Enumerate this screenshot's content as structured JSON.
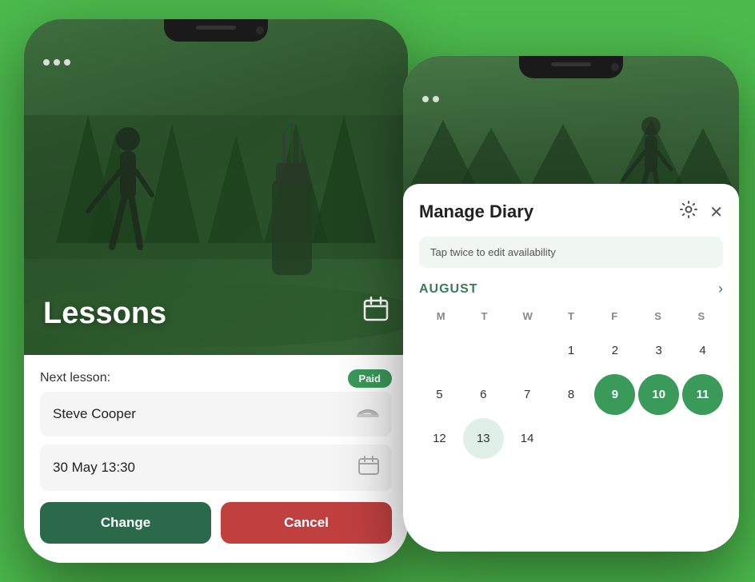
{
  "background_color": "#4cba4c",
  "phone_lessons": {
    "hero": {
      "dots_count": 3,
      "title": "Lessons",
      "calendar_icon": "📅"
    },
    "card": {
      "next_lesson_label": "Next lesson:",
      "paid_badge": "Paid",
      "student_name": "Steve Cooper",
      "student_icon": "🧢",
      "date_time": "30 May  13:30",
      "date_icon": "📅",
      "btn_change": "Change",
      "btn_cancel": "Cancel"
    }
  },
  "phone_diary": {
    "dots_count": 2,
    "modal": {
      "title": "Manage Diary",
      "settings_icon": "⚙",
      "close_icon": "✕",
      "hint": "Tap twice to edit availability",
      "calendar": {
        "month": "AUGUST",
        "weekdays": [
          "M",
          "T",
          "W",
          "T",
          "F",
          "S",
          "S"
        ],
        "weeks": [
          [
            {
              "day": "",
              "active": false,
              "today": false,
              "empty": true
            },
            {
              "day": "",
              "active": false,
              "today": false,
              "empty": true
            },
            {
              "day": "",
              "active": false,
              "today": false,
              "empty": true
            },
            {
              "day": "1",
              "active": false,
              "today": false,
              "empty": false
            },
            {
              "day": "2",
              "active": false,
              "today": false,
              "empty": false
            },
            {
              "day": "3",
              "active": false,
              "today": false,
              "empty": false
            },
            {
              "day": "4",
              "active": false,
              "today": false,
              "empty": false
            }
          ],
          [
            {
              "day": "5",
              "active": false,
              "today": false,
              "empty": false
            },
            {
              "day": "6",
              "active": false,
              "today": false,
              "empty": false
            },
            {
              "day": "7",
              "active": false,
              "today": false,
              "empty": false
            },
            {
              "day": "8",
              "active": false,
              "today": false,
              "empty": false
            },
            {
              "day": "9",
              "active": true,
              "today": false,
              "empty": false
            },
            {
              "day": "10",
              "active": true,
              "today": false,
              "empty": false
            },
            {
              "day": "11",
              "active": true,
              "today": false,
              "empty": false
            }
          ],
          [
            {
              "day": "12",
              "active": false,
              "today": false,
              "empty": false
            },
            {
              "day": "13",
              "active": false,
              "today": true,
              "empty": false
            },
            {
              "day": "14",
              "active": false,
              "today": false,
              "empty": false
            },
            {
              "day": "",
              "active": false,
              "today": false,
              "empty": true
            },
            {
              "day": "",
              "active": false,
              "today": false,
              "empty": true
            },
            {
              "day": "",
              "active": false,
              "today": false,
              "empty": true
            },
            {
              "day": "",
              "active": false,
              "today": false,
              "empty": true
            }
          ]
        ]
      }
    }
  }
}
